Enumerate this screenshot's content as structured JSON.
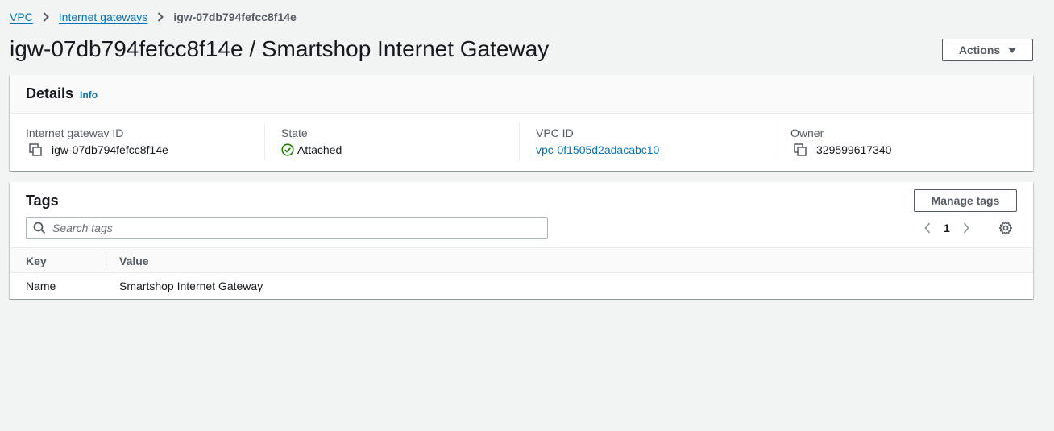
{
  "breadcrumb": {
    "items": [
      "VPC",
      "Internet gateways"
    ],
    "current": "igw-07db794fefcc8f14e"
  },
  "page": {
    "title": "igw-07db794fefcc8f14e / Smartshop Internet Gateway",
    "actions_label": "Actions"
  },
  "details": {
    "title": "Details",
    "info_label": "Info",
    "fields": [
      {
        "label": "Internet gateway ID",
        "value": "igw-07db794fefcc8f14e"
      },
      {
        "label": "State",
        "value": "Attached"
      },
      {
        "label": "VPC ID",
        "value": "vpc-0f1505d2adacabc10"
      },
      {
        "label": "Owner",
        "value": "329599617340"
      }
    ]
  },
  "tags": {
    "title": "Tags",
    "manage_label": "Manage tags",
    "search_placeholder": "Search tags",
    "page_number": "1",
    "columns": [
      "Key",
      "Value"
    ],
    "rows": [
      {
        "key": "Name",
        "value": "Smartshop Internet Gateway"
      }
    ]
  },
  "colors": {
    "link": "#0073bb",
    "success": "#1d8102",
    "background": "#f2f3f3"
  }
}
